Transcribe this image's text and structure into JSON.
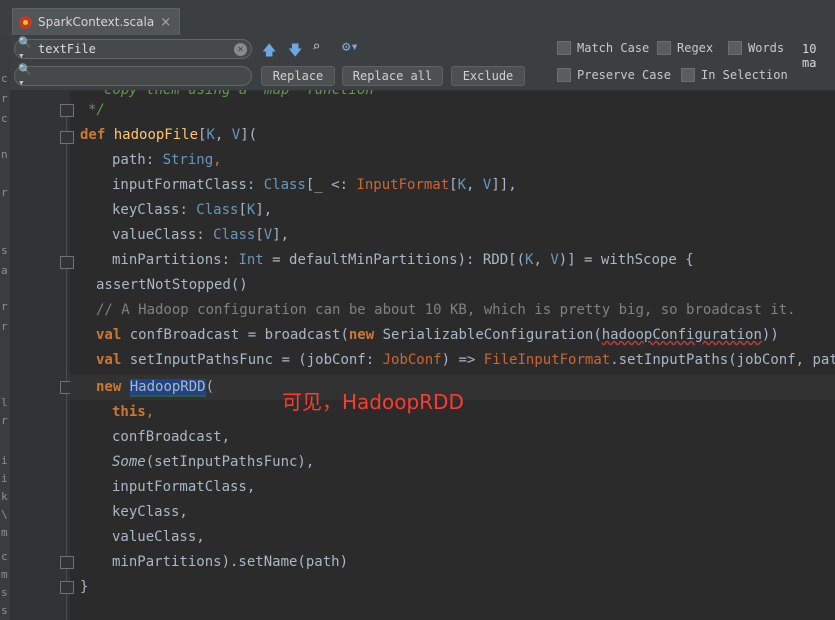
{
  "tab": {
    "title": "SparkContext.scala",
    "close": "×"
  },
  "find": {
    "search_value": "textFile",
    "replace_value": "",
    "clear": "×",
    "prev_icon": "arrow-up-icon",
    "next_icon": "arrow-down-icon",
    "find_in_icon": "find-occurrences-icon",
    "settings_icon": "gear-icon",
    "replace_label": "Replace",
    "replace_all_label": "Replace all",
    "exclude_label": "Exclude",
    "options": [
      "Match Case",
      "Regex",
      "Words",
      "Preserve Case",
      "In Selection"
    ],
    "matches": "10 ma"
  },
  "left_strip_letters": [
    "c",
    "r",
    "c",
    "n",
    "r",
    "s",
    "a",
    "r",
    "r",
    "l",
    "r",
    "i",
    "i",
    "k",
    "\\",
    "m",
    "c",
    "m",
    "s",
    "s"
  ],
  "code": {
    "l0": "copy them using a `map` function",
    "l1": "*/",
    "l2": {
      "kw": "def",
      "name": "hadoopFile",
      "a": "[",
      "K": "K",
      "c": ", ",
      "V": "V",
      "e": "]("
    },
    "l3": {
      "p": "path",
      "c": ": ",
      "t": "String",
      "e": ","
    },
    "l4": {
      "p": "inputFormatClass",
      "c": ": ",
      "t": "Class",
      "a": "[_ <: ",
      "t2": "InputFormat",
      "b": "[",
      "K": "K",
      "s": ", ",
      "V": "V",
      "e": "]],"
    },
    "l5": {
      "p": "keyClass",
      "c": ": ",
      "t": "Class",
      "a": "[",
      "K": "K",
      "e": "],"
    },
    "l6": {
      "p": "valueClass",
      "c": ": ",
      "t": "Class",
      "a": "[",
      "V": "V",
      "e": "],"
    },
    "l7": {
      "p": "minPartitions",
      "c": ": ",
      "t": "Int",
      "a": " = defaultMinPartitions): RDD[(",
      "K": "K",
      "s": ", ",
      "V": "V",
      "e": ")] = withScope {"
    },
    "l8": "assertNotStopped()",
    "l9": "// A Hadoop configuration can be about 10 KB, which is pretty big, so broadcast it.",
    "l10": {
      "kw": "val",
      "a": " confBroadcast = broadcast(",
      "kw2": "new",
      "b": " SerializableConfiguration(",
      "sq": "hadoopConfiguration",
      "e": "))"
    },
    "l11": {
      "kw": "val",
      "a": " setInputPathsFunc = (jobConf: ",
      "t": "JobConf",
      "b": ") => ",
      "t2": "FileInputFormat",
      "e": ".setInputPaths(jobConf, path)"
    },
    "l12": {
      "kw": "new",
      "sp": " ",
      "hl": "HadoopRDD",
      "e": "("
    },
    "l13": "this",
    "l13c": ",",
    "l14": "confBroadcast,",
    "l15": {
      "it": "Some",
      "e": "(setInputPathsFunc),"
    },
    "l16": "inputFormatClass,",
    "l17": "keyClass,",
    "l18": "valueClass,",
    "l19": "minPartitions).setName(path)",
    "l20": "}"
  },
  "annotation": "可见，HadoopRDD"
}
